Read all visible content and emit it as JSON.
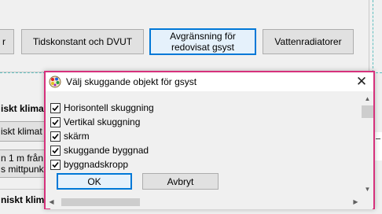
{
  "background": {
    "tabs": {
      "left_partial": "r",
      "tidskonstant": "Tidskonstant och DVUT",
      "avgransning_line1": "Avgränsning för",
      "avgransning_line2": "redovisat gsyst",
      "vattenradiatorer": "Vattenradiatorer"
    },
    "side": {
      "row1": "iskt klimat",
      "row2": "iskt klimat",
      "row3_line1": "n 1 m från",
      "row3_line2": "s mittpunkt",
      "row4": "niskt klima"
    }
  },
  "dialog": {
    "title": "Välj skuggande objekt för gsyst",
    "items": [
      {
        "label": "Horisontell skuggning",
        "checked": true
      },
      {
        "label": "Vertikal skuggning",
        "checked": true
      },
      {
        "label": "skärm",
        "checked": true
      },
      {
        "label": "skuggande byggnad",
        "checked": true
      },
      {
        "label": "byggnadskropp",
        "checked": true
      }
    ],
    "ok_label": "OK",
    "cancel_label": "Avbryt"
  },
  "colors": {
    "dialog_border": "#d6317c",
    "focus_blue": "#0078d7",
    "dashed_line": "#5fbfbf"
  }
}
